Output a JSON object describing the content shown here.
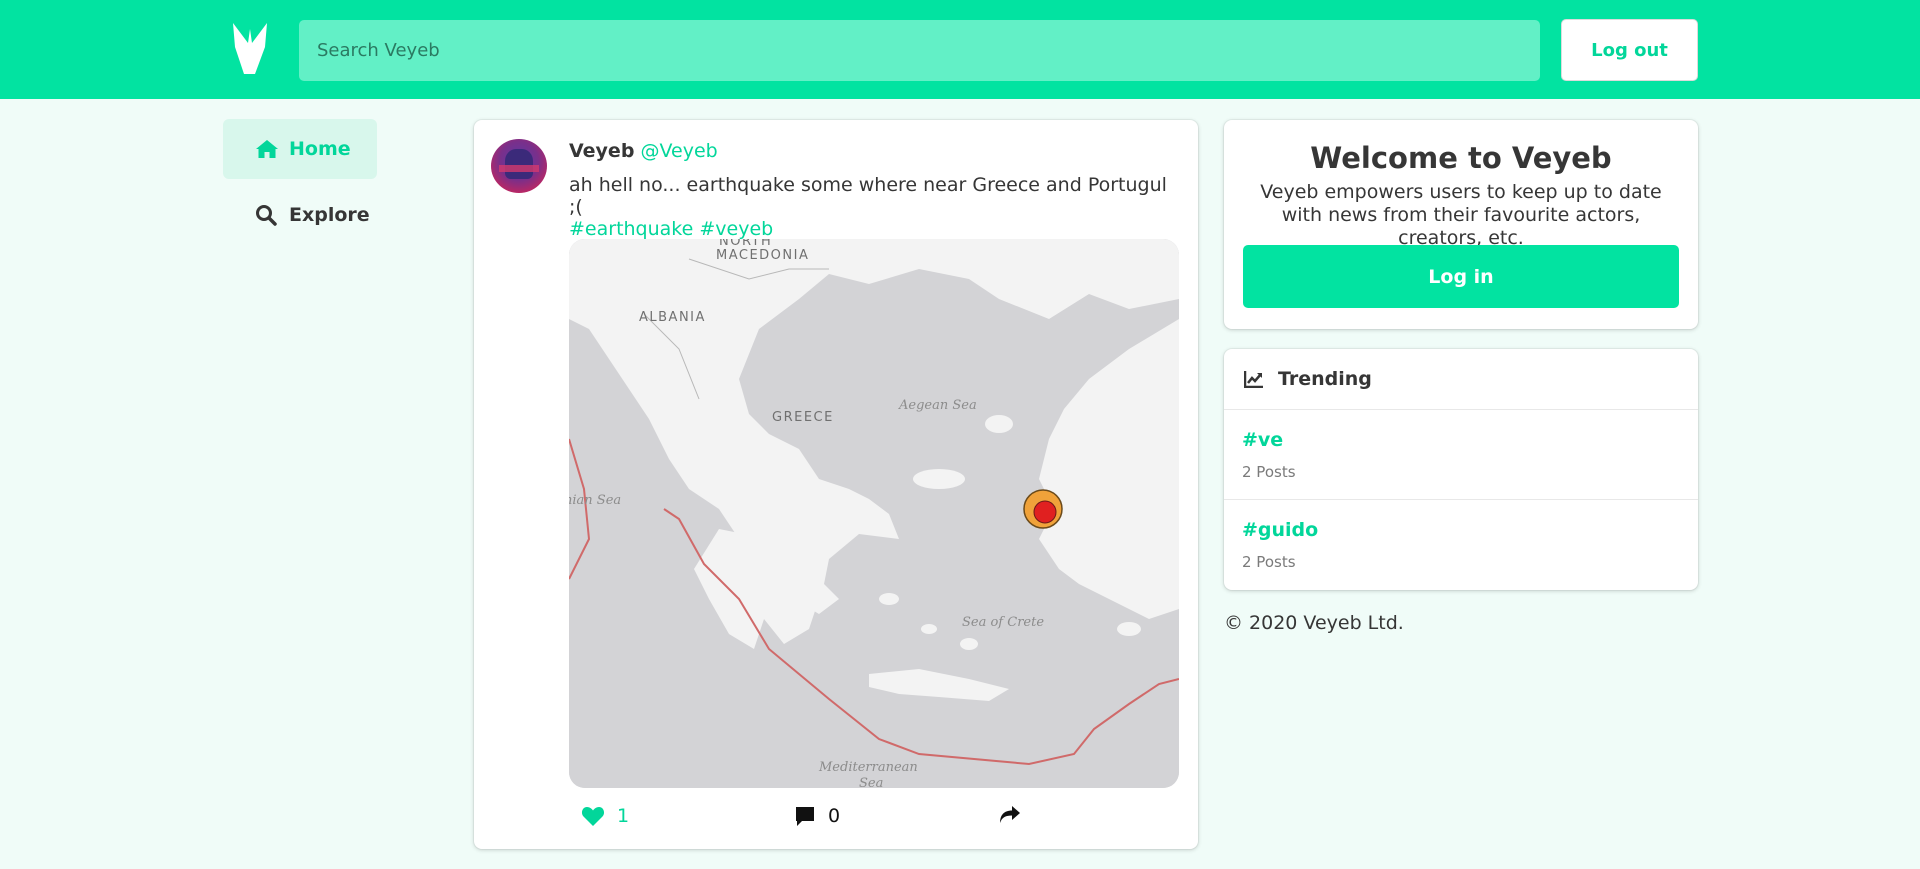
{
  "header": {
    "logo_icon": "veyeb-logo-icon",
    "search_placeholder": "Search Veyeb",
    "logout_label": "Log out",
    "accent_color": "#02e3a1"
  },
  "sidebar": {
    "items": [
      {
        "label": "Home",
        "icon": "home-icon",
        "active": true
      },
      {
        "label": "Explore",
        "icon": "search-icon",
        "active": false
      }
    ]
  },
  "post": {
    "author_name": "Veyeb",
    "author_handle": "@Veyeb",
    "text": "ah hell no... earthquake some where near Greece and Portugul ;(",
    "tags": [
      "#earthquake",
      "#veyeb"
    ],
    "map": {
      "labels": [
        "NORTH",
        "MACEDONIA",
        "ALBANIA",
        "GREECE"
      ],
      "seas": [
        "Aegean Sea",
        "nian Sea",
        "Sea of Crete",
        "Mediterranean",
        "Sea"
      ]
    },
    "likes": "1",
    "comments": "0"
  },
  "welcome": {
    "title": "Welcome to Veyeb",
    "description": "Veyeb empowers users to keep up to date with news from their favourite actors, creators, etc.",
    "login_label": "Log in"
  },
  "trending": {
    "title": "Trending",
    "items": [
      {
        "tag": "#ve",
        "count": "2 Posts"
      },
      {
        "tag": "#guido",
        "count": "2 Posts"
      }
    ]
  },
  "footer": {
    "copyright": "© 2020 Veyeb Ltd."
  }
}
